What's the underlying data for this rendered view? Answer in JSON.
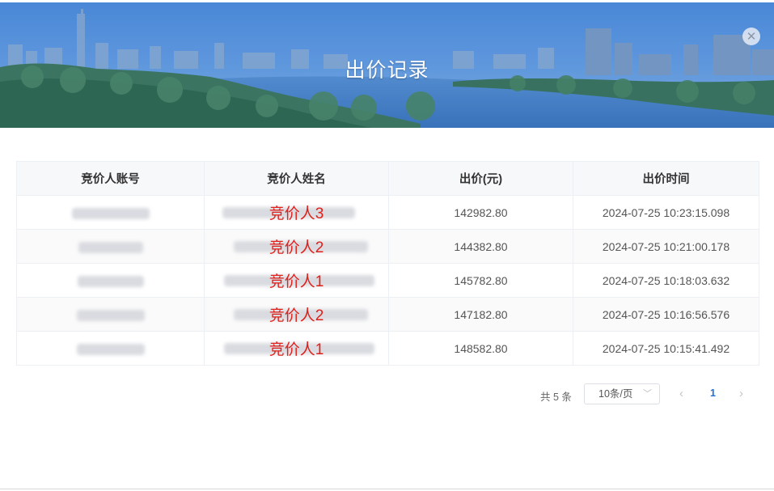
{
  "dialog": {
    "title": "出价记录",
    "close_icon": "close-icon"
  },
  "table": {
    "columns": [
      "竞价人账号",
      "竞价人姓名",
      "出价(元)",
      "出价时间"
    ],
    "rows": [
      {
        "bidder_name": "竞价人3",
        "price": "142982.80",
        "time": "2024-07-25 10:23:15.098"
      },
      {
        "bidder_name": "竞价人2",
        "price": "144382.80",
        "time": "2024-07-25 10:21:00.178"
      },
      {
        "bidder_name": "竞价人1",
        "price": "145782.80",
        "time": "2024-07-25 10:18:03.632"
      },
      {
        "bidder_name": "竞价人2",
        "price": "147182.80",
        "time": "2024-07-25 10:16:56.576"
      },
      {
        "bidder_name": "竞价人1",
        "price": "148582.80",
        "time": "2024-07-25 10:15:41.492"
      }
    ]
  },
  "pagination": {
    "total_text": "共 5 条",
    "page_size": "10条/页",
    "current_page": "1",
    "prev_icon": "chevron-left-icon",
    "next_icon": "chevron-right-icon",
    "dropdown_icon": "chevron-down-icon"
  }
}
